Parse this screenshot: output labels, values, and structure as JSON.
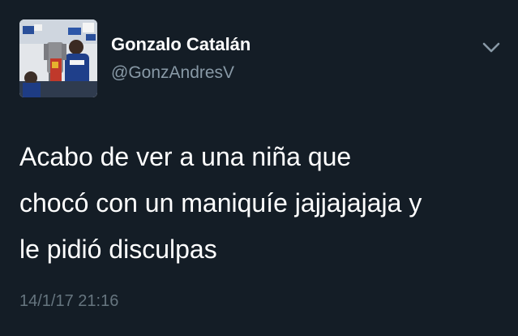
{
  "tweet": {
    "author": {
      "display_name": "Gonzalo Catalán",
      "handle": "@GonzAndresV",
      "avatar_icon": "profile-photo"
    },
    "menu_icon": "chevron-down-icon",
    "text": "Acabo de ver a una niña que\nchocó con un maniquíe jajjajajaja y\nle pidió disculpas",
    "timestamp": "14/1/17 21:16"
  },
  "colors": {
    "background": "#141d26",
    "text": "#ffffff",
    "secondary_text": "#8899a6",
    "timestamp": "#66757f"
  }
}
